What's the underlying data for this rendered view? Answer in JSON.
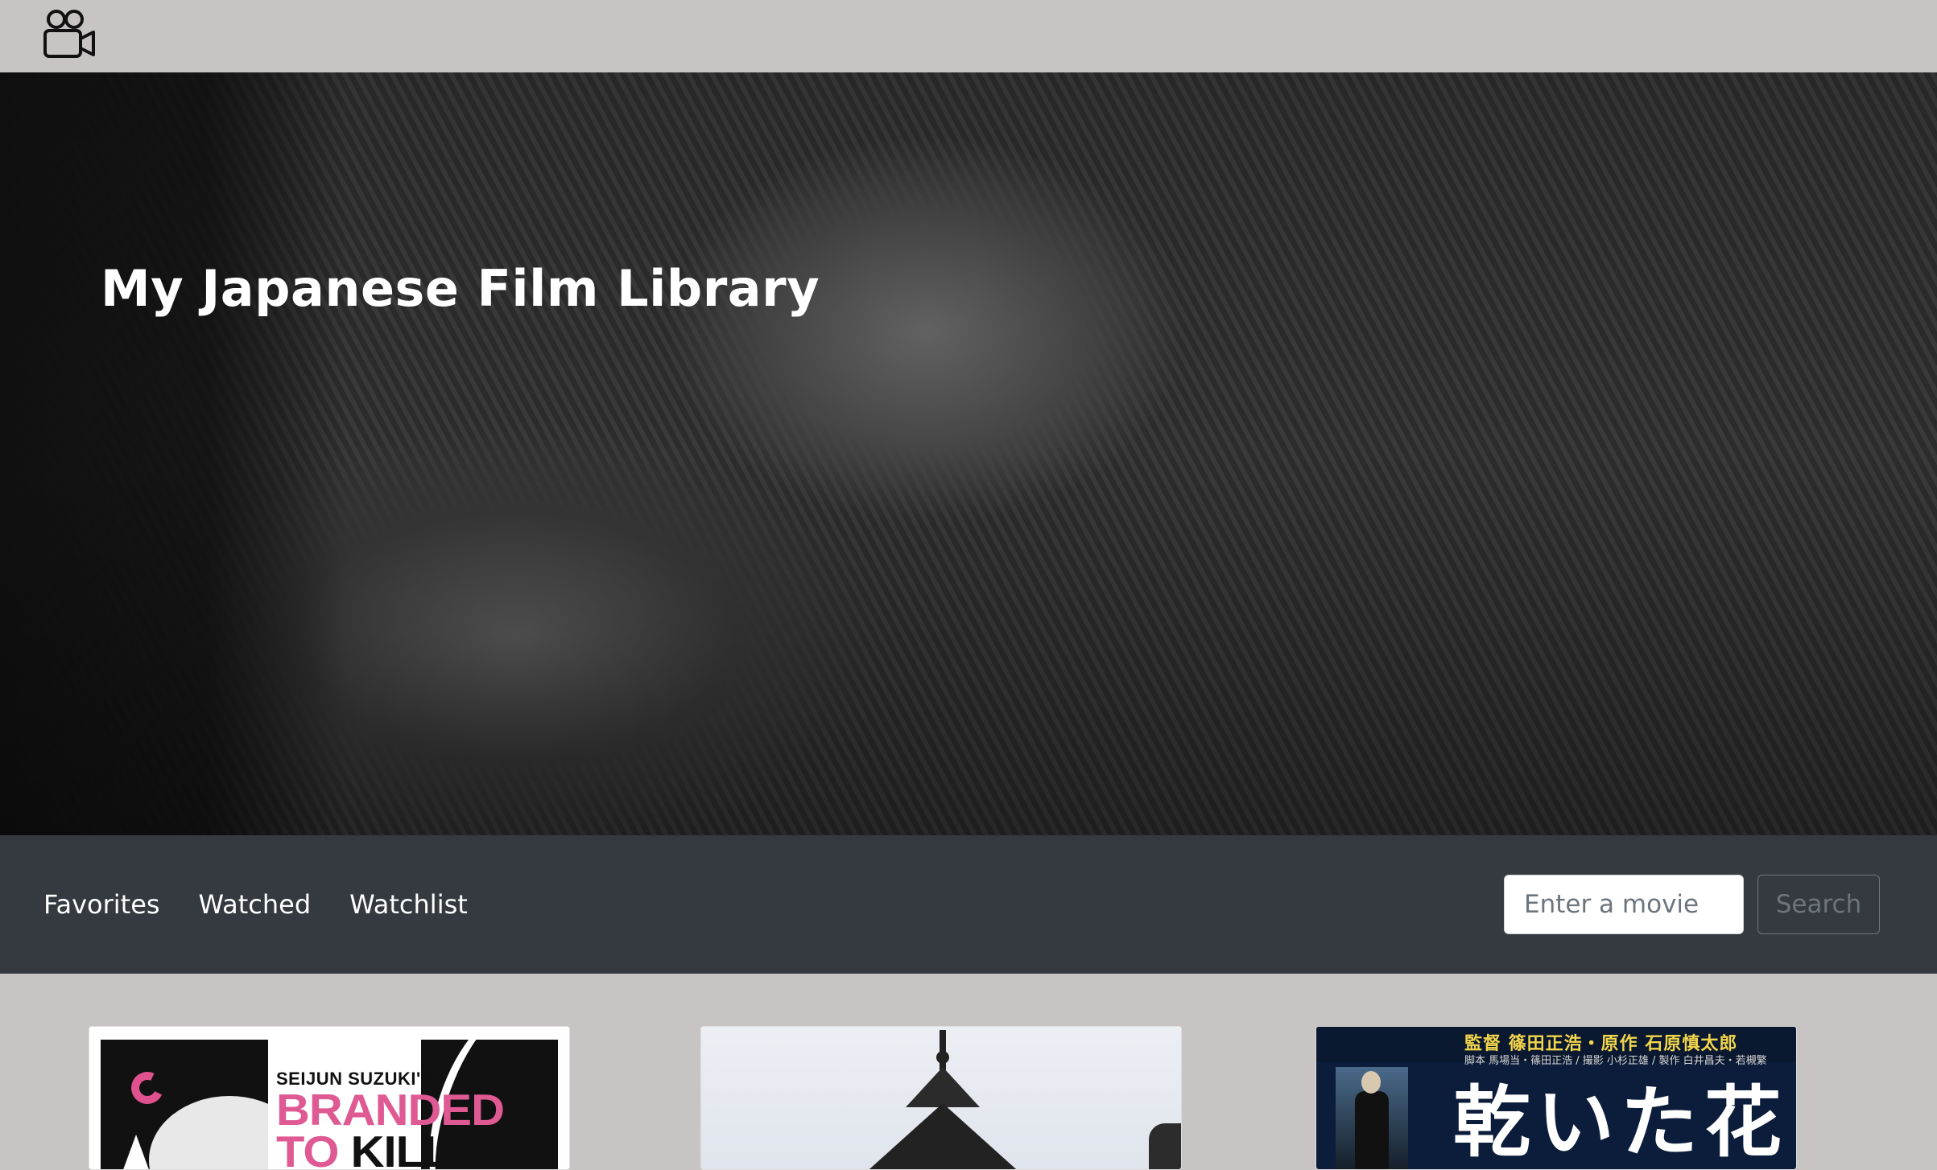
{
  "header": {
    "logo_icon": "movie-camera-icon"
  },
  "hero": {
    "title": "My Japanese Film Library"
  },
  "nav": {
    "links": [
      "Favorites",
      "Watched",
      "Watchlist"
    ],
    "search_placeholder": "Enter a movie",
    "search_button": "Search"
  },
  "movies": [
    {
      "poster_text_small": "SEIJUN SUZUKI'S",
      "poster_text_line1": "BRANDED",
      "poster_text_line2_a": "TO",
      "poster_text_line2_b": "KILL"
    },
    {
      "poster_icon": "pagoda-illustration"
    },
    {
      "poster_credits": "監督 篠田正浩・原作 石原慎太郎",
      "poster_credits_small": "脚本 馬場当・篠田正浩 / 撮影 小杉正雄 / 製作 白井昌夫・若槻繁",
      "poster_title": "乾いた花"
    }
  ],
  "colors": {
    "page_bg": "#c9c4c4",
    "navbar_bg": "#343a40",
    "accent_pink": "#df5a93"
  }
}
